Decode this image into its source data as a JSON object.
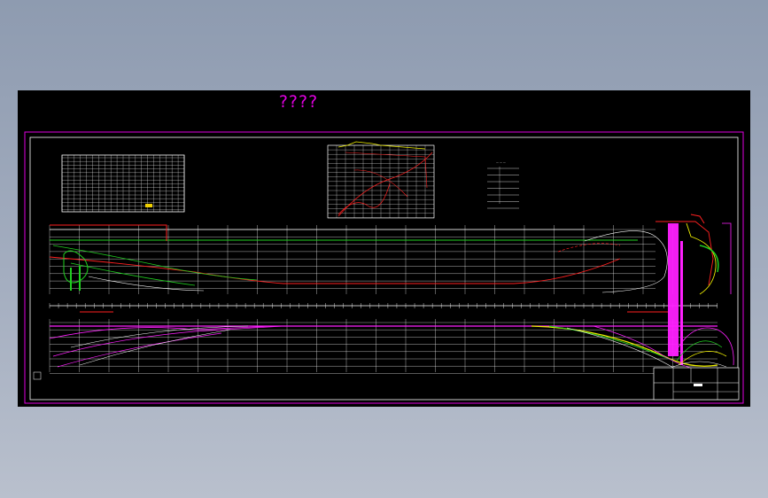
{
  "drawing": {
    "title": "????",
    "colors": {
      "background": "#000000",
      "frame": "#e000e0",
      "grid": "#ffffff",
      "hull_red": "#ff2020",
      "hull_green": "#20d020",
      "hull_yellow": "#f0f000",
      "hull_magenta": "#ff20ff"
    },
    "icons": [
      "offsets-table-icon",
      "hydrostatic-curves-icon",
      "principal-particulars-icon",
      "profile-view-icon",
      "half-breadth-view-icon",
      "body-plan-icon",
      "title-block-icon"
    ]
  }
}
